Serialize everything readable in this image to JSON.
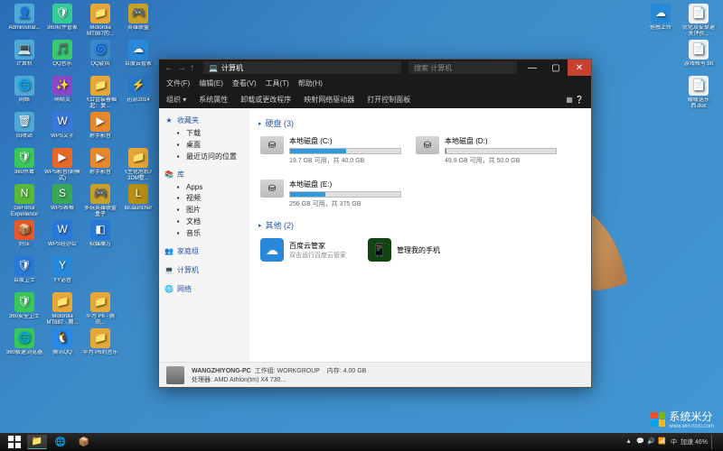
{
  "desktop": {
    "left_icons": [
      {
        "label": "Administrat...",
        "color": "#4fa8d8",
        "glyph": "👤"
      },
      {
        "label": "360软件管家",
        "color": "#3c9",
        "glyph": "🛡"
      },
      {
        "label": "Motorola MT887的...",
        "color": "#e8a838",
        "glyph": "📁"
      },
      {
        "label": "英雄联盟",
        "color": "#c8a028",
        "glyph": "🎮"
      },
      {
        "label": "",
        "color": "transparent",
        "glyph": ""
      },
      {
        "label": "计算机",
        "color": "#4fa8d8",
        "glyph": "💻"
      },
      {
        "label": "QQ音乐",
        "color": "#3cc86e",
        "glyph": "🎵"
      },
      {
        "label": "QQ旋风",
        "color": "#3c88c8",
        "glyph": "🌀"
      },
      {
        "label": "百度云管家",
        "color": "#2a88d8",
        "glyph": "☁"
      },
      {
        "label": "",
        "color": "transparent",
        "glyph": ""
      },
      {
        "label": "网络",
        "color": "#4fa8d8",
        "glyph": "🌐"
      },
      {
        "label": "萌精灵",
        "color": "#8848c8",
        "glyph": "✨"
      },
      {
        "label": "《合金装备崛起：复...",
        "color": "#e8a838",
        "glyph": "📁"
      },
      {
        "label": "迅游2014",
        "color": "#2878c8",
        "glyph": "⚡"
      },
      {
        "label": "",
        "color": "transparent",
        "glyph": ""
      },
      {
        "label": "回收站",
        "color": "#4fa8d8",
        "glyph": "🗑"
      },
      {
        "label": "WPS文字",
        "color": "#3878d8",
        "glyph": "W"
      },
      {
        "label": "射手影音",
        "color": "#e88828",
        "glyph": "▶"
      },
      {
        "label": "",
        "color": "transparent",
        "glyph": ""
      },
      {
        "label": "",
        "color": "transparent",
        "glyph": ""
      },
      {
        "label": "360杀毒",
        "color": "#38c858",
        "glyph": "🛡"
      },
      {
        "label": "WPS影音(剧模式)",
        "color": "#e86828",
        "glyph": "▶"
      },
      {
        "label": "射手影音",
        "color": "#e88828",
        "glyph": "▶"
      },
      {
        "label": "《生化危机》3DM整...",
        "color": "#e8a838",
        "glyph": "📁"
      },
      {
        "label": "",
        "color": "transparent",
        "glyph": ""
      },
      {
        "label": "GeForce Experience",
        "color": "#58b838",
        "glyph": "N"
      },
      {
        "label": "WPS表格",
        "color": "#38a858",
        "glyph": "S"
      },
      {
        "label": "多玩英雄联盟盒子",
        "color": "#c8a028",
        "glyph": "🎮"
      },
      {
        "label": "lol.launcher",
        "color": "#b89018",
        "glyph": "L"
      },
      {
        "label": "",
        "color": "transparent",
        "glyph": ""
      },
      {
        "label": "好压",
        "color": "#e85828",
        "glyph": "📦"
      },
      {
        "label": "WPS轻办公",
        "color": "#2878d8",
        "glyph": "W"
      },
      {
        "label": "软媒魔方",
        "color": "#2878d8",
        "glyph": "◧"
      },
      {
        "label": "",
        "color": "transparent",
        "glyph": ""
      },
      {
        "label": "",
        "color": "transparent",
        "glyph": ""
      },
      {
        "label": "百度卫士",
        "color": "#2878d8",
        "glyph": "🛡"
      },
      {
        "label": "YY语音",
        "color": "#2888d8",
        "glyph": "Y"
      },
      {
        "label": "",
        "color": "transparent",
        "glyph": ""
      },
      {
        "label": "",
        "color": "transparent",
        "glyph": ""
      },
      {
        "label": "",
        "color": "transparent",
        "glyph": ""
      },
      {
        "label": "360安全卫士",
        "color": "#38c858",
        "glyph": "🛡"
      },
      {
        "label": "Motorola MT887 - 腾...",
        "color": "#e8a838",
        "glyph": "📁"
      },
      {
        "label": "华为 P6 - 腾讯...",
        "color": "#e8a838",
        "glyph": "📁"
      },
      {
        "label": "",
        "color": "transparent",
        "glyph": ""
      },
      {
        "label": "",
        "color": "transparent",
        "glyph": ""
      },
      {
        "label": "360极速浏览器",
        "color": "#38c858",
        "glyph": "🌐"
      },
      {
        "label": "腾讯QQ",
        "color": "#2888e8",
        "glyph": "🐧"
      },
      {
        "label": "华为 P6的音乐",
        "color": "#e8a838",
        "glyph": "📁"
      }
    ],
    "right_icons": [
      {
        "label": "拖拽上传",
        "color": "#2a88d8",
        "glyph": "☁"
      },
      {
        "label": "优化及安卓通关评价...",
        "color": "#f0f0f0",
        "glyph": "📄"
      },
      {
        "label": "",
        "color": "transparent",
        "glyph": ""
      },
      {
        "label": "游戏帐号.txt",
        "color": "#f0f0f0",
        "glyph": "📄"
      },
      {
        "label": "",
        "color": "transparent",
        "glyph": ""
      },
      {
        "label": "暖暖送东西.doc",
        "color": "#f0f0f0",
        "glyph": "📄"
      }
    ]
  },
  "window": {
    "nav_back": "←",
    "nav_fwd": "→",
    "nav_up": "↑",
    "path_icon": "💻",
    "path_text": "计算机",
    "search_placeholder": "搜索 计算机",
    "menus": [
      "文件(F)",
      "编辑(E)",
      "查看(V)",
      "工具(T)",
      "帮助(H)"
    ],
    "tools": [
      "组织 ▾",
      "系统属性",
      "卸载或更改程序",
      "映射网络驱动器",
      "打开控制面板"
    ],
    "sidebar": {
      "favorites": {
        "hdr": "收藏夹",
        "items": [
          "下载",
          "桌面",
          "最近访问的位置"
        ]
      },
      "libraries": {
        "hdr": "库",
        "items": [
          "Apps",
          "视频",
          "图片",
          "文档",
          "音乐"
        ]
      },
      "homegroup": {
        "hdr": "家庭组"
      },
      "computer": {
        "hdr": "计算机"
      },
      "network": {
        "hdr": "网络"
      }
    },
    "content": {
      "drives_hdr": "硬盘 (3)",
      "drives": [
        {
          "name": "本地磁盘 (C:)",
          "free": "19.7 GB 可用，共 40.0 GB",
          "fill": 51
        },
        {
          "name": "本地磁盘 (D:)",
          "free": "49.9 GB 可用，共 50.0 GB",
          "fill": 1
        },
        {
          "name": "本地磁盘 (E:)",
          "free": "256 GB 可用，共 375 GB",
          "fill": 32
        }
      ],
      "others_hdr": "其他 (2)",
      "others": [
        {
          "name": "百度云管家",
          "sub": "双击运行百度云管家",
          "color": "#2a88d8",
          "glyph": "☁"
        },
        {
          "name": "管理我的手机",
          "sub": "",
          "color": "#114411",
          "glyph": "📱"
        }
      ]
    },
    "status": {
      "pc": "WANGZHIYONG-PC",
      "wg_lbl": "工作组:",
      "wg": "WORKGROUP",
      "mem_lbl": "内存:",
      "mem": "4.00 GB",
      "cpu_lbl": "处理器:",
      "cpu": "AMD Athlon(tm) X4 730..."
    }
  },
  "watermark": {
    "text": "系统米分",
    "sub": "www.win7000.com"
  },
  "taskbar": {
    "accel_label": "加速",
    "accel_pct": "46%",
    "tray_icons": [
      "▲",
      "💬",
      "🔊",
      "📶"
    ]
  }
}
